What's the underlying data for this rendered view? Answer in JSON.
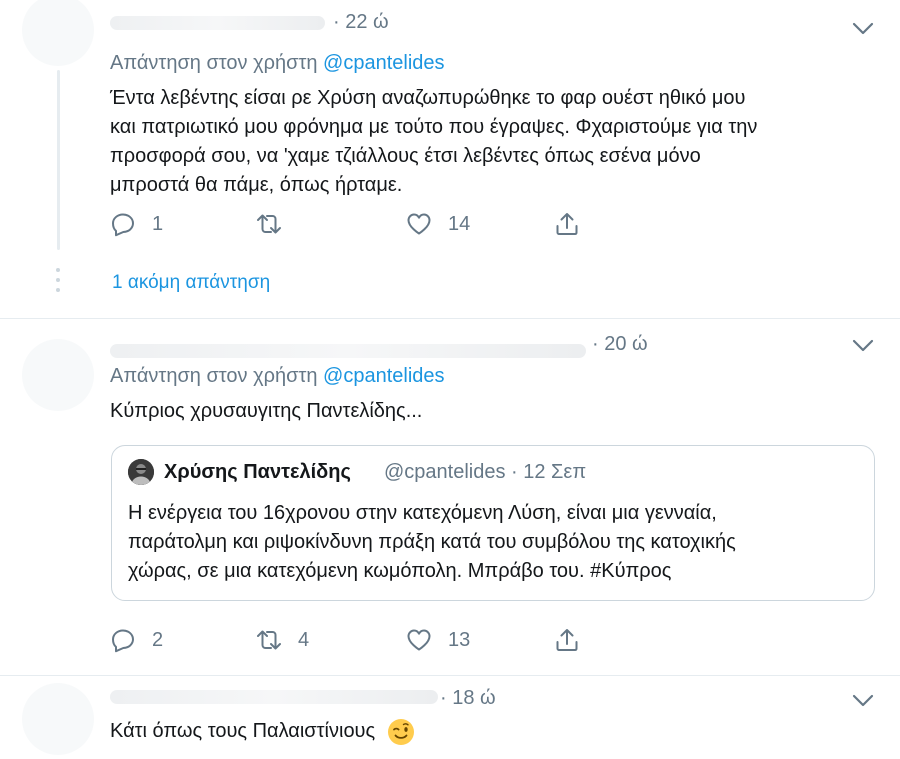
{
  "tweets": [
    {
      "time": "· 22 ώ",
      "reply_prefix": "Απάντηση στον χρήστη",
      "reply_handle": "@cpantelides",
      "text_lines": [
        "Έντα λεβέντης είσαι ρε Χρύση αναζωπυρώθηκε το φαρ ουέστ ηθικό μου",
        "και πατριωτικό μου φρόνημα με τούτο που έγραψες. Φχαριστούμε για την",
        "προσφορά σου, να 'χαμε τζιάλλους έτσι λεβέντες όπως εσένα μόνο",
        "μπροστά θα πάμε, όπως ήρταμε."
      ],
      "reply_count": "1",
      "retweet_count": "",
      "like_count": "14",
      "more_replies": "1 ακόμη απάντηση"
    },
    {
      "time": "· 20 ώ",
      "reply_prefix": "Απάντηση στον χρήστη",
      "reply_handle": "@cpantelides",
      "text": "Κύπριος χρυσαυγιτης Παντελίδης...",
      "quote": {
        "name": "Χρύσης Παντελίδης",
        "handle_time": "@cpantelides · 12 Σεπ",
        "text_lines": [
          "Η ενέργεια του 16χρονου στην κατεχόμενη Λύση, είναι μια γενναία,",
          "παράτολμη και ριψοκίνδυνη πράξη κατά του συμβόλου της κατοχικής",
          "χώρας, σε μια κατεχόμενη κωμόπολη. Μπράβο του. #Κύπρος"
        ]
      },
      "reply_count": "2",
      "retweet_count": "4",
      "like_count": "13"
    },
    {
      "time": "· 18 ώ",
      "text": "Κάτι όπως τους Παλαιστίνιους",
      "emoji": "winking-face"
    }
  ],
  "colors": {
    "accent": "#1b95e0",
    "secondary_text": "#657786",
    "border": "#e6ecf0"
  }
}
